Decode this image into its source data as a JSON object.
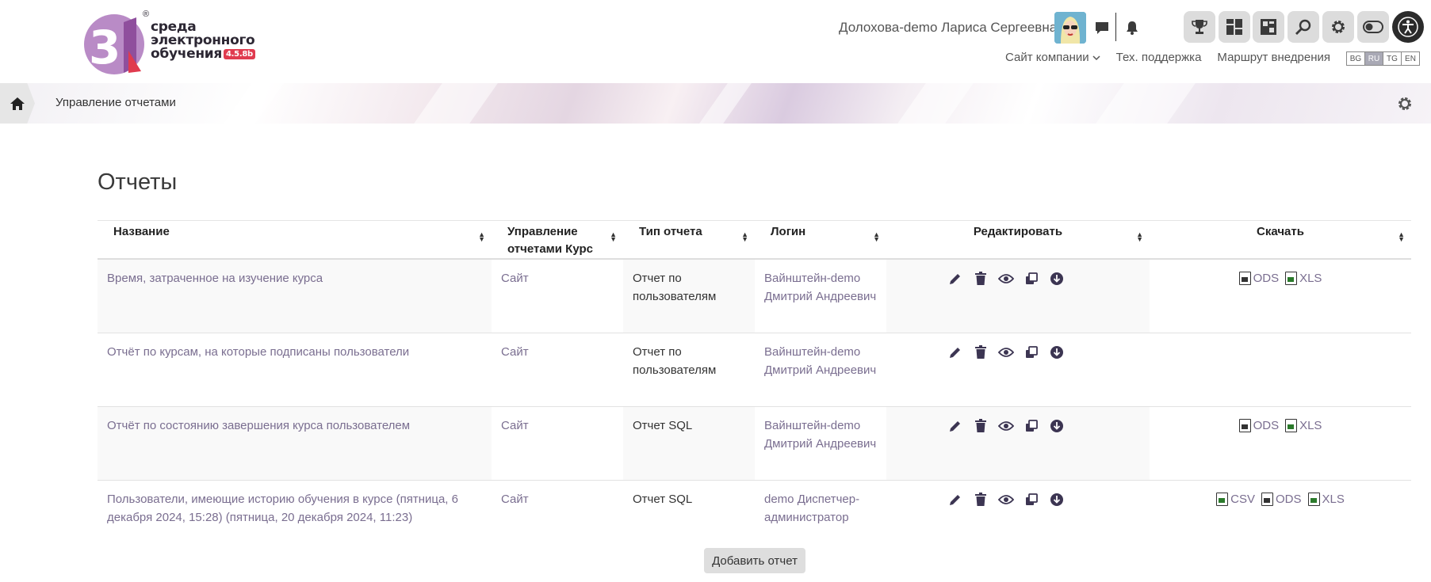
{
  "logo": {
    "line1": "среда",
    "line2": "электронного",
    "line3": "обучения",
    "version": "4.5.8b",
    "reg": "®"
  },
  "header": {
    "user_name": "Долохова-demo Лариса Сергеевна",
    "nav": {
      "company_site": "Сайт компании",
      "support": "Тех. поддержка",
      "route": "Маршрут внедрения"
    },
    "languages": [
      "BG",
      "RU",
      "TG",
      "EN"
    ],
    "active_language": "RU",
    "icons": [
      "chat-icon",
      "bell-icon",
      "trophy-icon",
      "dashboard-icon",
      "layout-icon",
      "search-icon",
      "gear-icon",
      "toggle-icon",
      "accessibility-icon"
    ]
  },
  "breadcrumb": {
    "current": "Управление отчетами"
  },
  "main": {
    "title": "Отчеты",
    "columns": {
      "name": "Название",
      "manage": "Управление отчетами Курс",
      "type": "Тип отчета",
      "login": "Логин",
      "edit": "Редактировать",
      "download": "Скачать"
    },
    "rows": [
      {
        "name": "Время, затраченное на изучение курса",
        "manage": "Сайт",
        "type": "Отчет по пользователям",
        "login": "Вайнштейн-demo Дмитрий Андреевич",
        "downloads": [
          "ODS",
          "XLS"
        ]
      },
      {
        "name": "Отчёт по курсам, на которые подписаны пользователи",
        "manage": "Сайт",
        "type": "Отчет по пользователям",
        "login": "Вайнштейн-demo Дмитрий Андреевич",
        "downloads": []
      },
      {
        "name": "Отчёт по состоянию завершения курса пользователем",
        "manage": "Сайт",
        "type": "Отчет SQL",
        "login": "Вайнштейн-demo Дмитрий Андреевич",
        "downloads": [
          "ODS",
          "XLS"
        ]
      },
      {
        "name": "Пользователи, имеющие историю обучения в курсе (пятница, 6 декабря 2024, 15:28) (пятница, 20 декабря 2024, 11:23)",
        "manage": "Сайт",
        "type": "Отчет SQL",
        "login": "demo Диспетчер-администратор",
        "downloads": [
          "CSV",
          "ODS",
          "XLS"
        ]
      }
    ],
    "add_button": "Добавить отчет"
  },
  "colors": {
    "link": "#7a6e90",
    "logo_purple": "#b07bbd",
    "logo_red": "#e03b4f",
    "button_bg": "#dedede"
  }
}
